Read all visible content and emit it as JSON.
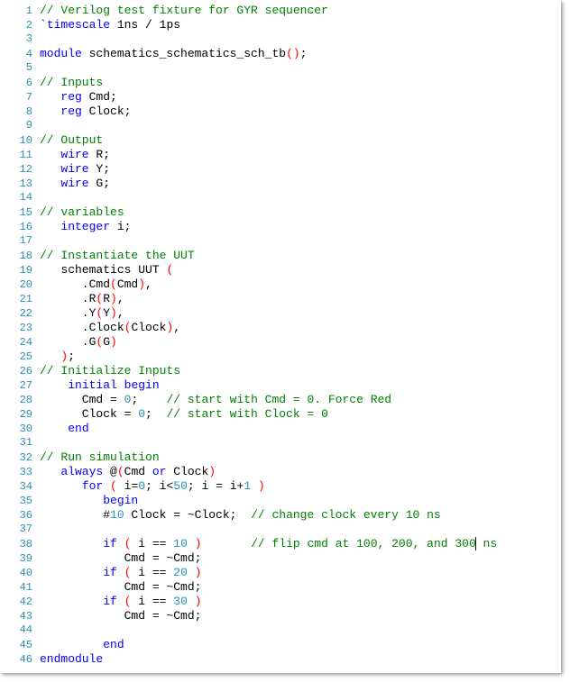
{
  "code": {
    "lines": [
      {
        "num": 1,
        "tokens": [
          {
            "cls": "c-comment",
            "txt": "// Verilog test fixture for GYR sequencer"
          }
        ]
      },
      {
        "num": 2,
        "tokens": [
          {
            "cls": "c-default",
            "txt": "`"
          },
          {
            "cls": "c-keyword",
            "txt": "timescale"
          },
          {
            "cls": "c-default",
            "txt": " 1ns / 1ps"
          }
        ]
      },
      {
        "num": 3,
        "tokens": []
      },
      {
        "num": 4,
        "tokens": [
          {
            "cls": "c-keyword",
            "txt": "module"
          },
          {
            "cls": "c-default",
            "txt": " schematics_schematics_sch_tb"
          },
          {
            "cls": "c-paren",
            "txt": "()"
          },
          {
            "cls": "c-default",
            "txt": ";"
          }
        ]
      },
      {
        "num": 5,
        "tokens": []
      },
      {
        "num": 6,
        "tokens": [
          {
            "cls": "c-comment",
            "txt": "// Inputs"
          }
        ]
      },
      {
        "num": 7,
        "tokens": [
          {
            "cls": "c-default",
            "txt": "   "
          },
          {
            "cls": "c-keyword",
            "txt": "reg"
          },
          {
            "cls": "c-default",
            "txt": " Cmd;"
          }
        ]
      },
      {
        "num": 8,
        "tokens": [
          {
            "cls": "c-default",
            "txt": "   "
          },
          {
            "cls": "c-keyword",
            "txt": "reg"
          },
          {
            "cls": "c-default",
            "txt": " Clock;"
          }
        ]
      },
      {
        "num": 9,
        "tokens": []
      },
      {
        "num": 10,
        "tokens": [
          {
            "cls": "c-comment",
            "txt": "// Output"
          }
        ]
      },
      {
        "num": 11,
        "tokens": [
          {
            "cls": "c-default",
            "txt": "   "
          },
          {
            "cls": "c-keyword",
            "txt": "wire"
          },
          {
            "cls": "c-default",
            "txt": " R;"
          }
        ]
      },
      {
        "num": 12,
        "tokens": [
          {
            "cls": "c-default",
            "txt": "   "
          },
          {
            "cls": "c-keyword",
            "txt": "wire"
          },
          {
            "cls": "c-default",
            "txt": " Y;"
          }
        ]
      },
      {
        "num": 13,
        "tokens": [
          {
            "cls": "c-default",
            "txt": "   "
          },
          {
            "cls": "c-keyword",
            "txt": "wire"
          },
          {
            "cls": "c-default",
            "txt": " G;"
          }
        ]
      },
      {
        "num": 14,
        "tokens": []
      },
      {
        "num": 15,
        "tokens": [
          {
            "cls": "c-comment",
            "txt": "// variables"
          }
        ]
      },
      {
        "num": 16,
        "tokens": [
          {
            "cls": "c-default",
            "txt": "   "
          },
          {
            "cls": "c-keyword",
            "txt": "integer"
          },
          {
            "cls": "c-default",
            "txt": " i;"
          }
        ]
      },
      {
        "num": 17,
        "tokens": []
      },
      {
        "num": 18,
        "tokens": [
          {
            "cls": "c-comment",
            "txt": "// Instantiate the UUT"
          }
        ]
      },
      {
        "num": 19,
        "tokens": [
          {
            "cls": "c-default",
            "txt": "   schematics UUT "
          },
          {
            "cls": "c-paren",
            "txt": "("
          }
        ]
      },
      {
        "num": 20,
        "tokens": [
          {
            "cls": "c-default",
            "txt": "      .Cmd"
          },
          {
            "cls": "c-paren",
            "txt": "("
          },
          {
            "cls": "c-default",
            "txt": "Cmd"
          },
          {
            "cls": "c-paren",
            "txt": ")"
          },
          {
            "cls": "c-default",
            "txt": ","
          }
        ]
      },
      {
        "num": 21,
        "tokens": [
          {
            "cls": "c-default",
            "txt": "      .R"
          },
          {
            "cls": "c-paren",
            "txt": "("
          },
          {
            "cls": "c-default",
            "txt": "R"
          },
          {
            "cls": "c-paren",
            "txt": ")"
          },
          {
            "cls": "c-default",
            "txt": ","
          }
        ]
      },
      {
        "num": 22,
        "tokens": [
          {
            "cls": "c-default",
            "txt": "      .Y"
          },
          {
            "cls": "c-paren",
            "txt": "("
          },
          {
            "cls": "c-default",
            "txt": "Y"
          },
          {
            "cls": "c-paren",
            "txt": ")"
          },
          {
            "cls": "c-default",
            "txt": ","
          }
        ]
      },
      {
        "num": 23,
        "tokens": [
          {
            "cls": "c-default",
            "txt": "      .Clock"
          },
          {
            "cls": "c-paren",
            "txt": "("
          },
          {
            "cls": "c-default",
            "txt": "Clock"
          },
          {
            "cls": "c-paren",
            "txt": ")"
          },
          {
            "cls": "c-default",
            "txt": ","
          }
        ]
      },
      {
        "num": 24,
        "tokens": [
          {
            "cls": "c-default",
            "txt": "      .G"
          },
          {
            "cls": "c-paren",
            "txt": "("
          },
          {
            "cls": "c-default",
            "txt": "G"
          },
          {
            "cls": "c-paren",
            "txt": ")"
          }
        ]
      },
      {
        "num": 25,
        "tokens": [
          {
            "cls": "c-default",
            "txt": "   "
          },
          {
            "cls": "c-paren",
            "txt": ")"
          },
          {
            "cls": "c-default",
            "txt": ";"
          }
        ]
      },
      {
        "num": 26,
        "tokens": [
          {
            "cls": "c-comment",
            "txt": "// Initialize Inputs"
          }
        ]
      },
      {
        "num": 27,
        "tokens": [
          {
            "cls": "c-default",
            "txt": "    "
          },
          {
            "cls": "c-keyword",
            "txt": "initial"
          },
          {
            "cls": "c-default",
            "txt": " "
          },
          {
            "cls": "c-keyword",
            "txt": "begin"
          }
        ]
      },
      {
        "num": 28,
        "tokens": [
          {
            "cls": "c-default",
            "txt": "      Cmd = "
          },
          {
            "cls": "c-num",
            "txt": "0"
          },
          {
            "cls": "c-default",
            "txt": ";    "
          },
          {
            "cls": "c-comment",
            "txt": "// start with Cmd = 0. Force Red"
          }
        ]
      },
      {
        "num": 29,
        "tokens": [
          {
            "cls": "c-default",
            "txt": "      Clock = "
          },
          {
            "cls": "c-num",
            "txt": "0"
          },
          {
            "cls": "c-default",
            "txt": ";  "
          },
          {
            "cls": "c-comment",
            "txt": "// start with Clock = 0"
          }
        ]
      },
      {
        "num": 30,
        "tokens": [
          {
            "cls": "c-default",
            "txt": "    "
          },
          {
            "cls": "c-keyword",
            "txt": "end"
          }
        ]
      },
      {
        "num": 31,
        "tokens": []
      },
      {
        "num": 32,
        "tokens": [
          {
            "cls": "c-comment",
            "txt": "// Run simulation"
          }
        ]
      },
      {
        "num": 33,
        "tokens": [
          {
            "cls": "c-default",
            "txt": "   "
          },
          {
            "cls": "c-keyword",
            "txt": "always"
          },
          {
            "cls": "c-default",
            "txt": " @"
          },
          {
            "cls": "c-paren",
            "txt": "("
          },
          {
            "cls": "c-default",
            "txt": "Cmd "
          },
          {
            "cls": "c-keyword",
            "txt": "or"
          },
          {
            "cls": "c-default",
            "txt": " Clock"
          },
          {
            "cls": "c-paren",
            "txt": ")"
          }
        ]
      },
      {
        "num": 34,
        "tokens": [
          {
            "cls": "c-default",
            "txt": "      "
          },
          {
            "cls": "c-keyword",
            "txt": "for"
          },
          {
            "cls": "c-default",
            "txt": " "
          },
          {
            "cls": "c-paren",
            "txt": "("
          },
          {
            "cls": "c-default",
            "txt": " i="
          },
          {
            "cls": "c-num",
            "txt": "0"
          },
          {
            "cls": "c-default",
            "txt": "; i<"
          },
          {
            "cls": "c-num",
            "txt": "50"
          },
          {
            "cls": "c-default",
            "txt": "; i = i+"
          },
          {
            "cls": "c-num",
            "txt": "1"
          },
          {
            "cls": "c-default",
            "txt": " "
          },
          {
            "cls": "c-paren",
            "txt": ")"
          }
        ]
      },
      {
        "num": 35,
        "tokens": [
          {
            "cls": "c-default",
            "txt": "         "
          },
          {
            "cls": "c-keyword",
            "txt": "begin"
          }
        ]
      },
      {
        "num": 36,
        "tokens": [
          {
            "cls": "c-default",
            "txt": "         #"
          },
          {
            "cls": "c-num",
            "txt": "10"
          },
          {
            "cls": "c-default",
            "txt": " Clock = ~Clock;  "
          },
          {
            "cls": "c-comment",
            "txt": "// change clock every 10 ns"
          }
        ]
      },
      {
        "num": 37,
        "tokens": []
      },
      {
        "num": 38,
        "tokens": [
          {
            "cls": "c-default",
            "txt": "         "
          },
          {
            "cls": "c-keyword",
            "txt": "if"
          },
          {
            "cls": "c-default",
            "txt": " "
          },
          {
            "cls": "c-paren",
            "txt": "("
          },
          {
            "cls": "c-default",
            "txt": " i == "
          },
          {
            "cls": "c-num",
            "txt": "10"
          },
          {
            "cls": "c-default",
            "txt": " "
          },
          {
            "cls": "c-paren",
            "txt": ")"
          },
          {
            "cls": "c-default",
            "txt": "       "
          },
          {
            "cls": "c-comment",
            "txt": "// flip cmd at 100, 200, and 300"
          },
          {
            "cls": "c-comment cursor",
            "txt": ""
          },
          {
            "cls": "c-comment",
            "txt": " ns"
          }
        ]
      },
      {
        "num": 39,
        "tokens": [
          {
            "cls": "c-default",
            "txt": "            Cmd = ~Cmd;"
          }
        ]
      },
      {
        "num": 40,
        "tokens": [
          {
            "cls": "c-default",
            "txt": "         "
          },
          {
            "cls": "c-keyword",
            "txt": "if"
          },
          {
            "cls": "c-default",
            "txt": " "
          },
          {
            "cls": "c-paren",
            "txt": "("
          },
          {
            "cls": "c-default",
            "txt": " i == "
          },
          {
            "cls": "c-num",
            "txt": "20"
          },
          {
            "cls": "c-default",
            "txt": " "
          },
          {
            "cls": "c-paren",
            "txt": ")"
          }
        ]
      },
      {
        "num": 41,
        "tokens": [
          {
            "cls": "c-default",
            "txt": "            Cmd = ~Cmd;"
          }
        ]
      },
      {
        "num": 42,
        "tokens": [
          {
            "cls": "c-default",
            "txt": "         "
          },
          {
            "cls": "c-keyword",
            "txt": "if"
          },
          {
            "cls": "c-default",
            "txt": " "
          },
          {
            "cls": "c-paren",
            "txt": "("
          },
          {
            "cls": "c-default",
            "txt": " i == "
          },
          {
            "cls": "c-num",
            "txt": "30"
          },
          {
            "cls": "c-default",
            "txt": " "
          },
          {
            "cls": "c-paren",
            "txt": ")"
          }
        ]
      },
      {
        "num": 43,
        "tokens": [
          {
            "cls": "c-default",
            "txt": "            Cmd = ~Cmd;"
          }
        ]
      },
      {
        "num": 44,
        "tokens": []
      },
      {
        "num": 45,
        "tokens": [
          {
            "cls": "c-default",
            "txt": "         "
          },
          {
            "cls": "c-keyword",
            "txt": "end"
          }
        ]
      },
      {
        "num": 46,
        "tokens": [
          {
            "cls": "c-keyword",
            "txt": "endmodule"
          }
        ]
      }
    ]
  }
}
